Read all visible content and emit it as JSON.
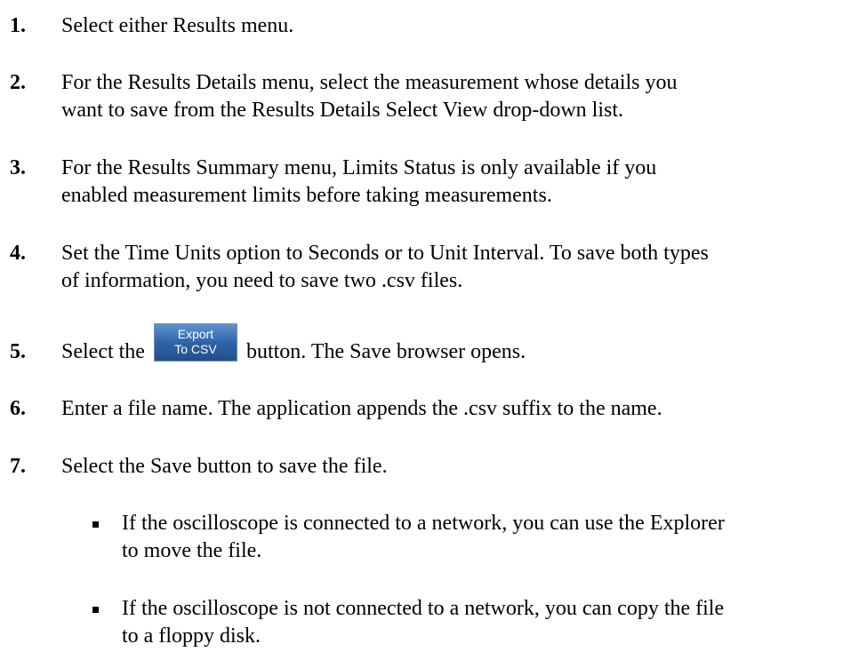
{
  "steps": [
    {
      "num": "1.",
      "text": "Select either Results menu."
    },
    {
      "num": "2.",
      "line1": "For the Results Details menu, select the measurement whose details you",
      "line2": "want to save from the Results Details Select View drop-down list."
    },
    {
      "num": "3.",
      "line1": "For the Results Summary menu, Limits Status is only available if you",
      "line2": "enabled measurement limits before taking measurements."
    },
    {
      "num": "4.",
      "line1": "Set the Time Units option to Seconds or to Unit Interval. To save both types",
      "line2": "of information, you need to save two .csv files."
    },
    {
      "num": "5.",
      "before": "Select the",
      "button_line1": "Export",
      "button_line2": "To CSV",
      "after": "button. The Save browser opens."
    },
    {
      "num": "6.",
      "text": "Enter a file name. The application appends the .csv suffix to the name."
    },
    {
      "num": "7.",
      "text": "Select the Save button to save the file."
    }
  ],
  "bullets": [
    {
      "line1": "If the oscilloscope is connected to a network, you can use the Explorer",
      "line2": "to move the file."
    },
    {
      "line1": "If the oscilloscope is not connected to a network, you can copy the file",
      "line2": "to a floppy disk."
    }
  ]
}
